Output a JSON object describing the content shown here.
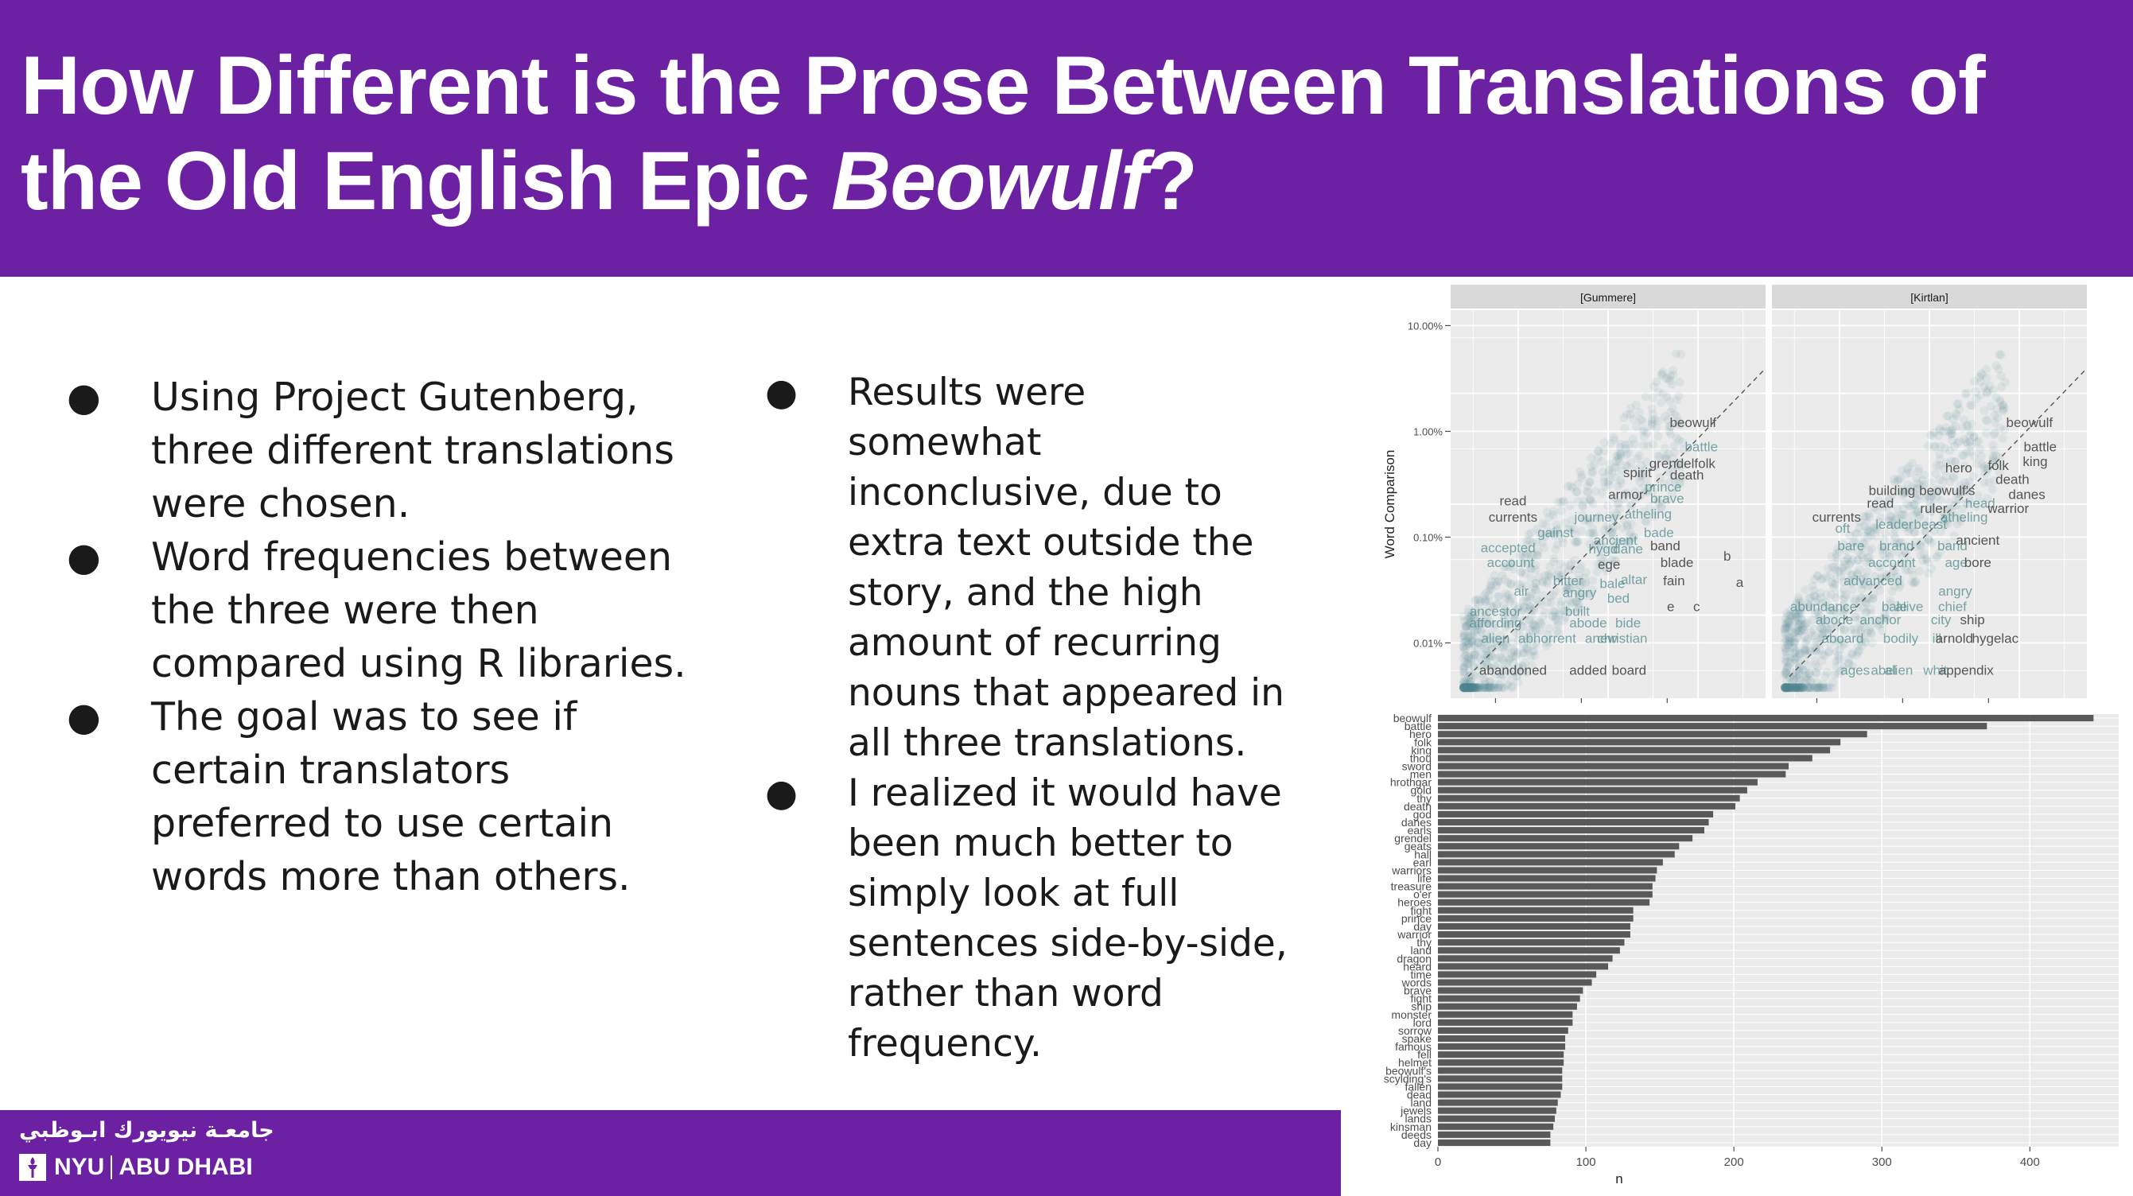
{
  "slide": {
    "title_pre": "How Different is the Prose Between  Translations of the Old English Epic ",
    "title_em": "Beowulf",
    "title_post": "?"
  },
  "bullets_left": [
    "Using Project Gutenberg, three different translations were chosen.",
    "Word frequencies between the three were then compared using R libraries.",
    "The goal was to see if certain translators preferred to use certain words more than others."
  ],
  "bullets_right": [
    "Results were somewhat inconclusive, due to extra text outside the story, and the high amount of recurring nouns that appeared in all three translations.",
    "I realized it would have been much better to simply look at full sentences side-by-side, rather than word frequency."
  ],
  "bullet_glyph": "●",
  "logo": {
    "arabic": "جامعـة نيويورك ابـوظبي",
    "nyu": "NYU",
    "abu_dhabi": "ABU DHABI"
  },
  "colors": {
    "brand_purple": "#6b21a1",
    "panel_bg": "#ebebeb",
    "strip_bg": "#d9d9d9",
    "point_teal": "#4f8a8b",
    "bar_fill": "#595959"
  },
  "chart_data": [
    {
      "type": "scatter",
      "ylabel": "Word Comparison",
      "xlabel": "",
      "title": "",
      "log_scale": true,
      "grid": true,
      "facets": [
        "[Gummere]",
        "[Kirtlan]"
      ],
      "y_ticks": [
        "10.00%",
        "1.00%",
        "0.10%",
        "0.01%"
      ],
      "y_tick_values": [
        0.1,
        0.01,
        0.001,
        0.0001
      ],
      "ylim": [
        3e-05,
        0.14
      ],
      "xlim": [
        3e-05,
        0.14
      ],
      "diagonal_reference": true,
      "labels": [
        [
          {
            "t": "beowulf",
            "x": 0.02,
            "y": 0.011,
            "h": false
          },
          {
            "t": "battle",
            "x": 0.025,
            "y": 0.0065,
            "h": true
          },
          {
            "t": "grendelfolk",
            "x": 0.015,
            "y": 0.0045,
            "h": false
          },
          {
            "t": "death",
            "x": 0.017,
            "y": 0.0035,
            "h": false
          },
          {
            "t": "spirit",
            "x": 0.0045,
            "y": 0.0037,
            "h": false
          },
          {
            "t": "prince",
            "x": 0.009,
            "y": 0.0027,
            "h": true
          },
          {
            "t": "brave",
            "x": 0.01,
            "y": 0.0021,
            "h": true
          },
          {
            "t": "armor",
            "x": 0.0033,
            "y": 0.0023,
            "h": false
          },
          {
            "t": "read",
            "x": 0.00016,
            "y": 0.002,
            "h": false
          },
          {
            "t": "currents",
            "x": 0.00016,
            "y": 0.0014,
            "h": false
          },
          {
            "t": "journey",
            "x": 0.0015,
            "y": 0.0014,
            "h": true
          },
          {
            "t": "atheling",
            "x": 0.006,
            "y": 0.0015,
            "h": true
          },
          {
            "t": "gainst",
            "x": 0.0005,
            "y": 0.001,
            "h": true
          },
          {
            "t": "ancient",
            "x": 0.0025,
            "y": 0.00085,
            "h": true
          },
          {
            "t": "bade",
            "x": 0.008,
            "y": 0.001,
            "h": true
          },
          {
            "t": "accepted",
            "x": 0.00014,
            "y": 0.00072,
            "h": true
          },
          {
            "t": "hygd",
            "x": 0.0018,
            "y": 0.0007,
            "h": true
          },
          {
            "t": "dane",
            "x": 0.0035,
            "y": 0.0007,
            "h": true
          },
          {
            "t": "band",
            "x": 0.0095,
            "y": 0.00075,
            "h": false
          },
          {
            "t": "b",
            "x": 0.05,
            "y": 0.0006,
            "h": false
          },
          {
            "t": "account",
            "x": 0.00015,
            "y": 0.00052,
            "h": true
          },
          {
            "t": "ege",
            "x": 0.0021,
            "y": 0.0005,
            "h": false
          },
          {
            "t": "blade",
            "x": 0.013,
            "y": 0.00052,
            "h": false
          },
          {
            "t": "bitter",
            "x": 0.0007,
            "y": 0.00035,
            "h": true
          },
          {
            "t": "bale",
            "x": 0.0023,
            "y": 0.00033,
            "h": true
          },
          {
            "t": "altar",
            "x": 0.0041,
            "y": 0.00036,
            "h": true
          },
          {
            "t": "fain",
            "x": 0.012,
            "y": 0.00035,
            "h": false
          },
          {
            "t": "a",
            "x": 0.07,
            "y": 0.00034,
            "h": false
          },
          {
            "t": "air",
            "x": 0.0002,
            "y": 0.00028,
            "h": true
          },
          {
            "t": "angry",
            "x": 0.00095,
            "y": 0.00027,
            "h": true
          },
          {
            "t": "bed",
            "x": 0.0027,
            "y": 0.00024,
            "h": true
          },
          {
            "t": "e",
            "x": 0.011,
            "y": 0.0002,
            "h": false
          },
          {
            "t": "c",
            "x": 0.022,
            "y": 0.0002,
            "h": false
          },
          {
            "t": "ancestor",
            "x": 0.0001,
            "y": 0.00018,
            "h": true
          },
          {
            "t": "built",
            "x": 0.0009,
            "y": 0.00018,
            "h": true
          },
          {
            "t": "abode",
            "x": 0.0012,
            "y": 0.00014,
            "h": true
          },
          {
            "t": "bide",
            "x": 0.0035,
            "y": 0.00014,
            "h": true
          },
          {
            "t": "affording",
            "x": 0.0001,
            "y": 0.00014,
            "h": true
          },
          {
            "t": "alien",
            "x": 0.0001,
            "y": 0.0001,
            "h": true
          },
          {
            "t": "anew",
            "x": 0.0017,
            "y": 0.0001,
            "h": true
          },
          {
            "t": "abhorrent",
            "x": 0.0004,
            "y": 0.0001,
            "h": true
          },
          {
            "t": "christian",
            "x": 0.003,
            "y": 0.0001,
            "h": true
          },
          {
            "t": "abandoned",
            "x": 0.00016,
            "y": 5e-05,
            "h": false
          },
          {
            "t": "added",
            "x": 0.0012,
            "y": 5e-05,
            "h": false
          },
          {
            "t": "board",
            "x": 0.0036,
            "y": 5e-05,
            "h": false
          }
        ],
        [
          {
            "t": "beowulf",
            "x": 0.03,
            "y": 0.011,
            "h": false
          },
          {
            "t": "battle",
            "x": 0.04,
            "y": 0.0065,
            "h": false
          },
          {
            "t": "king",
            "x": 0.035,
            "y": 0.0047,
            "h": false
          },
          {
            "t": "hero",
            "x": 0.0045,
            "y": 0.0041,
            "h": false
          },
          {
            "t": "folk",
            "x": 0.013,
            "y": 0.0043,
            "h": false
          },
          {
            "t": "death",
            "x": 0.019,
            "y": 0.0032,
            "h": false
          },
          {
            "t": "building",
            "x": 0.00075,
            "y": 0.0025,
            "h": false
          },
          {
            "t": "beowulf's",
            "x": 0.0033,
            "y": 0.0025,
            "h": false
          },
          {
            "t": "danes",
            "x": 0.028,
            "y": 0.0023,
            "h": false
          },
          {
            "t": "read",
            "x": 0.00055,
            "y": 0.0019,
            "h": false
          },
          {
            "t": "ruler",
            "x": 0.0023,
            "y": 0.0017,
            "h": false
          },
          {
            "t": "head",
            "x": 0.008,
            "y": 0.0019,
            "h": true
          },
          {
            "t": "warrior",
            "x": 0.017,
            "y": 0.0017,
            "h": false
          },
          {
            "t": "currents",
            "x": 0.00017,
            "y": 0.0014,
            "h": false
          },
          {
            "t": "leader",
            "x": 0.0008,
            "y": 0.0012,
            "h": true
          },
          {
            "t": "beast",
            "x": 0.0021,
            "y": 0.0012,
            "h": true
          },
          {
            "t": "atheling",
            "x": 0.0052,
            "y": 0.0014,
            "h": true
          },
          {
            "t": "oft",
            "x": 0.0002,
            "y": 0.0011,
            "h": true
          },
          {
            "t": "ancient",
            "x": 0.0075,
            "y": 0.00085,
            "h": false
          },
          {
            "t": "bare",
            "x": 0.00025,
            "y": 0.00075,
            "h": true
          },
          {
            "t": "brand",
            "x": 0.00085,
            "y": 0.00075,
            "h": true
          },
          {
            "t": "band",
            "x": 0.0038,
            "y": 0.00075,
            "h": true
          },
          {
            "t": "account",
            "x": 0.00075,
            "y": 0.00052,
            "h": true
          },
          {
            "t": "age",
            "x": 0.0042,
            "y": 0.00052,
            "h": true
          },
          {
            "t": "bore",
            "x": 0.0075,
            "y": 0.00052,
            "h": false
          },
          {
            "t": "advanced",
            "x": 0.00045,
            "y": 0.00035,
            "h": true
          },
          {
            "t": "angry",
            "x": 0.0041,
            "y": 0.00028,
            "h": true
          },
          {
            "t": "abundance",
            "x": 0.00012,
            "y": 0.0002,
            "h": true
          },
          {
            "t": "bale",
            "x": 0.0008,
            "y": 0.0002,
            "h": true
          },
          {
            "t": "alive",
            "x": 0.0012,
            "y": 0.0002,
            "h": true
          },
          {
            "t": "chief",
            "x": 0.0038,
            "y": 0.0002,
            "h": true
          },
          {
            "t": "abode",
            "x": 0.00016,
            "y": 0.00015,
            "h": true
          },
          {
            "t": "anchor",
            "x": 0.00055,
            "y": 0.00015,
            "h": true
          },
          {
            "t": "city",
            "x": 0.0028,
            "y": 0.00015,
            "h": true
          },
          {
            "t": "ship",
            "x": 0.0065,
            "y": 0.00015,
            "h": false
          },
          {
            "t": "aboard",
            "x": 0.0002,
            "y": 0.0001,
            "h": true
          },
          {
            "t": "bodily",
            "x": 0.00095,
            "y": 0.0001,
            "h": true
          },
          {
            "t": "ill",
            "x": 0.0025,
            "y": 0.0001,
            "h": true
          },
          {
            "t": "arnold",
            "x": 0.004,
            "y": 0.0001,
            "h": false
          },
          {
            "t": "hygelac",
            "x": 0.012,
            "y": 0.0001,
            "h": false
          },
          {
            "t": "ages",
            "x": 0.00028,
            "y": 5e-05,
            "h": true
          },
          {
            "t": "abel",
            "x": 0.0006,
            "y": 5e-05,
            "h": true
          },
          {
            "t": "alien",
            "x": 0.0009,
            "y": 5e-05,
            "h": true
          },
          {
            "t": "whit",
            "x": 0.0024,
            "y": 5e-05,
            "h": true
          },
          {
            "t": "appendix",
            "x": 0.0055,
            "y": 5e-05,
            "h": false
          }
        ]
      ]
    },
    {
      "type": "bar",
      "orientation": "horizontal",
      "xlabel": "n",
      "ylabel": "",
      "title": "",
      "grid": true,
      "xlim": [
        0,
        460
      ],
      "x_ticks": [
        0,
        100,
        200,
        300,
        400
      ],
      "categories": [
        "beowulf",
        "battle",
        "hero",
        "folk",
        "king",
        "thou",
        "sword",
        "men",
        "hrothgar",
        "gold",
        "thy",
        "death",
        "god",
        "danes",
        "earls",
        "grendel",
        "geats",
        "hall",
        "earl",
        "warriors",
        "life",
        "treasure",
        "o'er",
        "heroes",
        "fight",
        "prince",
        "day",
        "warrior",
        "thy",
        "land",
        "dragon",
        "heard",
        "time",
        "words",
        "brave",
        "fight",
        "ship",
        "monster",
        "lord",
        "sorrow",
        "spake",
        "famous",
        "fell",
        "helmet",
        "beowulf's",
        "scylding's",
        "fallen",
        "dead",
        "land",
        "jewels",
        "lands",
        "kinsman",
        "deeds",
        "day"
      ],
      "values": [
        443,
        371,
        290,
        272,
        265,
        253,
        237,
        235,
        216,
        209,
        204,
        201,
        186,
        183,
        180,
        172,
        163,
        160,
        152,
        148,
        147,
        145,
        145,
        143,
        132,
        132,
        130,
        130,
        126,
        123,
        118,
        115,
        107,
        104,
        98,
        96,
        94,
        91,
        91,
        88,
        86,
        86,
        85,
        85,
        84,
        84,
        84,
        83,
        81,
        80,
        79,
        78,
        76,
        76
      ]
    }
  ]
}
